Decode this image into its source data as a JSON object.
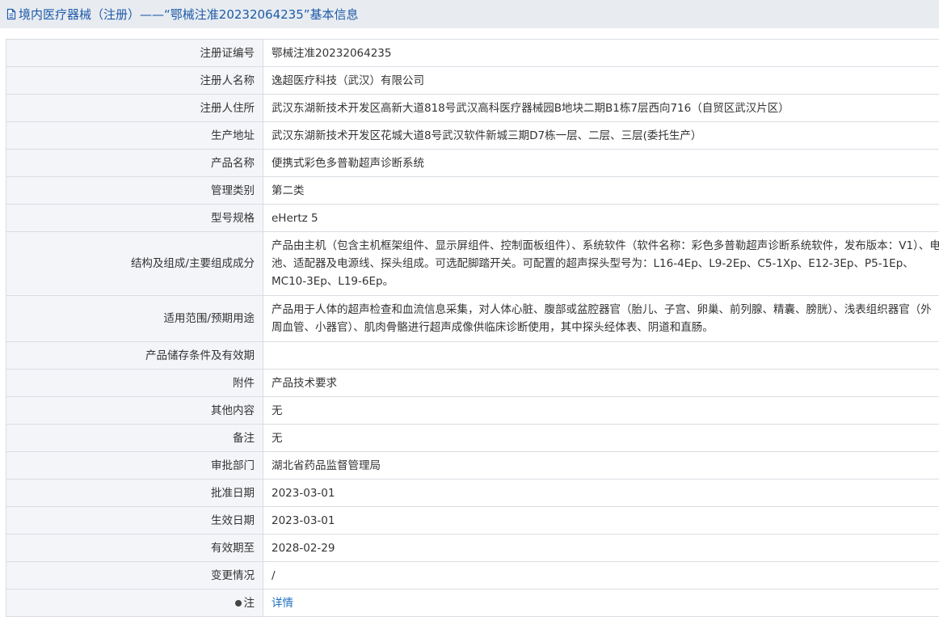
{
  "header": {
    "title": "境内医疗器械（注册）——“鄂械注准20232064235”基本信息",
    "icon": "document-icon"
  },
  "rows": [
    {
      "label": "注册证编号",
      "value": "鄂械注准20232064235"
    },
    {
      "label": "注册人名称",
      "value": "逸超医疗科技（武汉）有限公司"
    },
    {
      "label": "注册人住所",
      "value": "武汉东湖新技术开发区高新大道818号武汉高科医疗器械园B地块二期B1栋7层西向716（自贸区武汉片区）"
    },
    {
      "label": "生产地址",
      "value": "武汉东湖新技术开发区花城大道8号武汉软件新城三期D7栋一层、二层、三层(委托生产）"
    },
    {
      "label": "产品名称",
      "value": "便携式彩色多普勒超声诊断系统"
    },
    {
      "label": "管理类别",
      "value": "第二类"
    },
    {
      "label": "型号规格",
      "value": "eHertz 5"
    },
    {
      "label": "结构及组成/主要组成成分",
      "value": "产品由主机（包含主机框架组件、显示屏组件、控制面板组件）、系统软件（软件名称：彩色多普勒超声诊断系统软件，发布版本：V1）、电池、适配器及电源线、探头组成。可选配脚踏开关。可配置的超声探头型号为：L16-4Ep、L9-2Ep、C5-1Xp、E12-3Ep、P5-1Ep、MC10-3Ep、L19-6Ep。"
    },
    {
      "label": "适用范围/预期用途",
      "value": "产品用于人体的超声检查和血流信息采集，对人体心脏、腹部或盆腔器官（胎儿、子宫、卵巢、前列腺、精囊、膀胱）、浅表组织器官（外周血管、小器官）、肌肉骨骼进行超声成像供临床诊断使用，其中探头经体表、阴道和直肠。"
    },
    {
      "label": "产品储存条件及有效期",
      "value": ""
    },
    {
      "label": "附件",
      "value": "产品技术要求"
    },
    {
      "label": "其他内容",
      "value": "无"
    },
    {
      "label": "备注",
      "value": "无"
    },
    {
      "label": "审批部门",
      "value": "湖北省药品监督管理局"
    },
    {
      "label": "批准日期",
      "value": "2023-03-01"
    },
    {
      "label": "生效日期",
      "value": "2023-03-01"
    },
    {
      "label": "有效期至",
      "value": "2028-02-29"
    },
    {
      "label": "变更情况",
      "value": "/"
    }
  ],
  "note_row": {
    "label": "注",
    "link": "详情"
  },
  "colors": {
    "title_text": "#1d5aa7",
    "title_bg": "#e8ecf1",
    "label_bg": "#f3f5f8",
    "border": "#d9dde3",
    "link": "#1d6fc1"
  }
}
